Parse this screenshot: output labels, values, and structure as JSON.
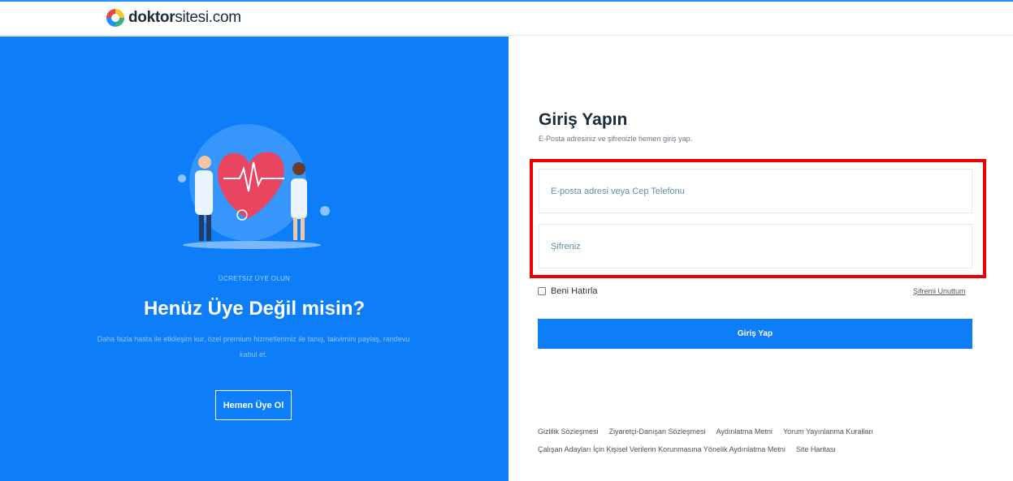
{
  "header": {
    "logo_bold": "doktor",
    "logo_rest": "sitesi.com"
  },
  "left": {
    "tagline": "ÜCRETSIZ ÜYE OLUN",
    "title": "Henüz Üye Değil misin?",
    "description": "Daha fazla hasta ile etkileşim kur, özel premium hizmetlerimiz ile tanış, takvimini paylaş, randevu kabul et.",
    "join_button": "Hemen Üye Ol"
  },
  "form": {
    "title": "Giriş Yapın",
    "subtitle": "E-Posta adresiniz ve şifrenizle hemen giriş yap.",
    "email_placeholder": "E-posta adresi veya Cep Telefonu",
    "password_placeholder": "Şifreniz",
    "remember_label": "Beni Hatırla",
    "forgot_link": "Şifremi Unuttum",
    "submit_label": "Giriş Yap"
  },
  "footer": {
    "row1": [
      "Gizlilik Sözleşmesi",
      "Ziyaretçi-Danışan Sözleşmesi",
      "Aydınlatma Metni",
      "Yorum Yayınlanma Kuralları"
    ],
    "row2": [
      "Çalışan Adayları İçin Kişisel Verilerin Korunmasına Yönelik Aydınlatma Metni",
      "Site Haritası"
    ]
  },
  "colors": {
    "brand_blue": "#0d7ef7",
    "highlight_red": "#ee0000"
  }
}
